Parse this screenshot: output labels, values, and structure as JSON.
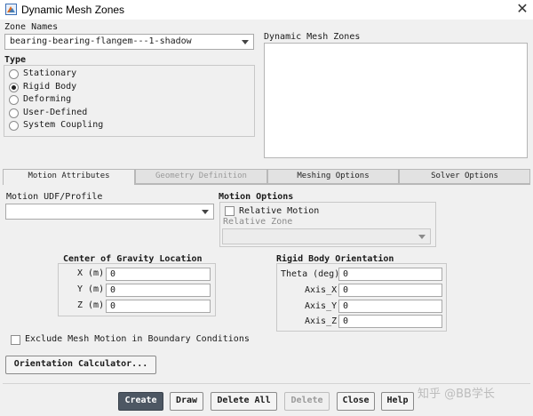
{
  "window": {
    "title": "Dynamic Mesh Zones",
    "close_glyph": "✕"
  },
  "zone_names": {
    "label": "Zone Names",
    "selected": "bearing-bearing-flangem---1-shadow"
  },
  "dynamic_mesh_zones": {
    "label": "Dynamic Mesh Zones"
  },
  "type": {
    "label": "Type",
    "options": [
      "Stationary",
      "Rigid Body",
      "Deforming",
      "User-Defined",
      "System Coupling"
    ],
    "selected": "Rigid Body"
  },
  "tabs": [
    "Motion Attributes",
    "Geometry Definition",
    "Meshing Options",
    "Solver Options"
  ],
  "active_tab": "Motion Attributes",
  "motion_udf": {
    "label": "Motion UDF/Profile",
    "selected": ""
  },
  "motion_options": {
    "label": "Motion Options",
    "relative_motion_label": "Relative Motion",
    "relative_motion_checked": false,
    "relative_zone_label": "Relative Zone",
    "relative_zone_value": ""
  },
  "cog": {
    "label": "Center of Gravity Location",
    "fields": [
      {
        "label": "X (m)",
        "value": "0"
      },
      {
        "label": "Y (m)",
        "value": "0"
      },
      {
        "label": "Z (m)",
        "value": "0"
      }
    ]
  },
  "rbo": {
    "label": "Rigid Body Orientation",
    "fields": [
      {
        "label": "Theta (deg)",
        "value": "0"
      },
      {
        "label": "Axis_X",
        "value": "0"
      },
      {
        "label": "Axis_Y",
        "value": "0"
      },
      {
        "label": "Axis_Z",
        "value": "0"
      }
    ]
  },
  "exclude": {
    "label": "Exclude Mesh Motion in Boundary Conditions",
    "checked": false
  },
  "orientation_button": "Orientation Calculator...",
  "buttons": {
    "create": "Create",
    "draw": "Draw",
    "delete_all": "Delete All",
    "delete": "Delete",
    "close": "Close",
    "help": "Help"
  },
  "watermark": "知乎 @BB学长",
  "colors": {
    "primary_button": "#4d5763",
    "background": "#f0f0f0"
  },
  "icons": {
    "app": "fluent-app-icon",
    "close": "close-icon"
  }
}
